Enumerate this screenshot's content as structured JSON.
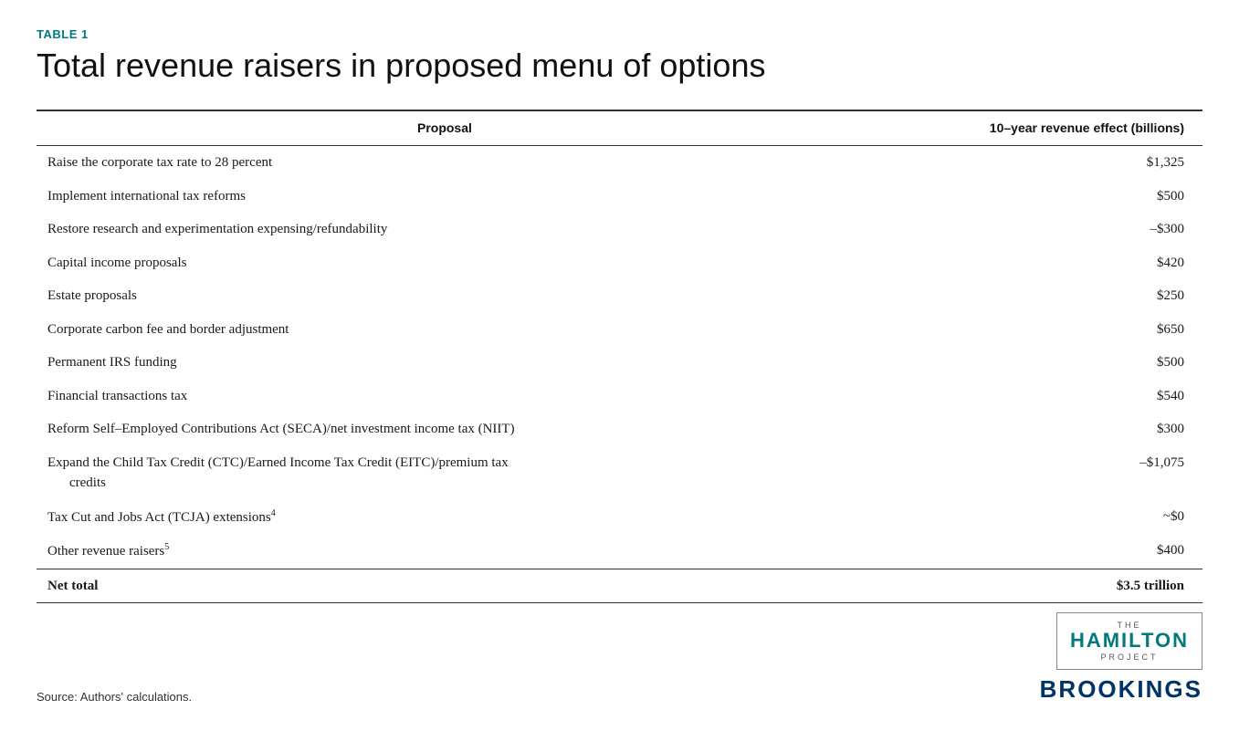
{
  "table_label": "TABLE 1",
  "table_title": "Total revenue raisers in proposed menu of options",
  "columns": {
    "proposal": "Proposal",
    "revenue": "10–year revenue effect (billions)"
  },
  "rows": [
    {
      "proposal": "Raise the corporate tax rate to 28 percent",
      "revenue": "$1,325",
      "multiline": false
    },
    {
      "proposal": "Implement international tax reforms",
      "revenue": "$500",
      "multiline": false
    },
    {
      "proposal": "Restore research and experimentation expensing/refundability",
      "revenue": "–$300",
      "multiline": false
    },
    {
      "proposal": "Capital income proposals",
      "revenue": "$420",
      "multiline": false
    },
    {
      "proposal": "Estate proposals",
      "revenue": "$250",
      "multiline": false
    },
    {
      "proposal": "Corporate carbon fee and border adjustment",
      "revenue": "$650",
      "multiline": false
    },
    {
      "proposal": "Permanent IRS funding",
      "revenue": "$500",
      "multiline": false
    },
    {
      "proposal": "Financial transactions tax",
      "revenue": "$540",
      "multiline": false
    },
    {
      "proposal": "Reform Self–Employed Contributions Act (SECA)/net investment income tax (NIIT)",
      "revenue": "$300",
      "multiline": false
    },
    {
      "proposal_line1": "Expand the Child Tax Credit (CTC)/Earned Income Tax Credit (EITC)/premium tax",
      "proposal_line2": "credits",
      "revenue": "–$1,075",
      "multiline": true
    },
    {
      "proposal": "Tax Cut and Jobs Act (TCJA) extensions",
      "superscript": "4",
      "revenue": "~$0",
      "multiline": false
    },
    {
      "proposal": "Other revenue raisers",
      "superscript": "5",
      "revenue": "$400",
      "multiline": false
    }
  ],
  "net_total": {
    "label": "Net total",
    "value": "$3.5 trillion"
  },
  "source": "Source: Authors' calculations.",
  "logos": {
    "hamilton_the": "THE",
    "hamilton_main": "HAMILTON",
    "hamilton_project": "PROJECT",
    "brookings": "BROOKINGS"
  }
}
